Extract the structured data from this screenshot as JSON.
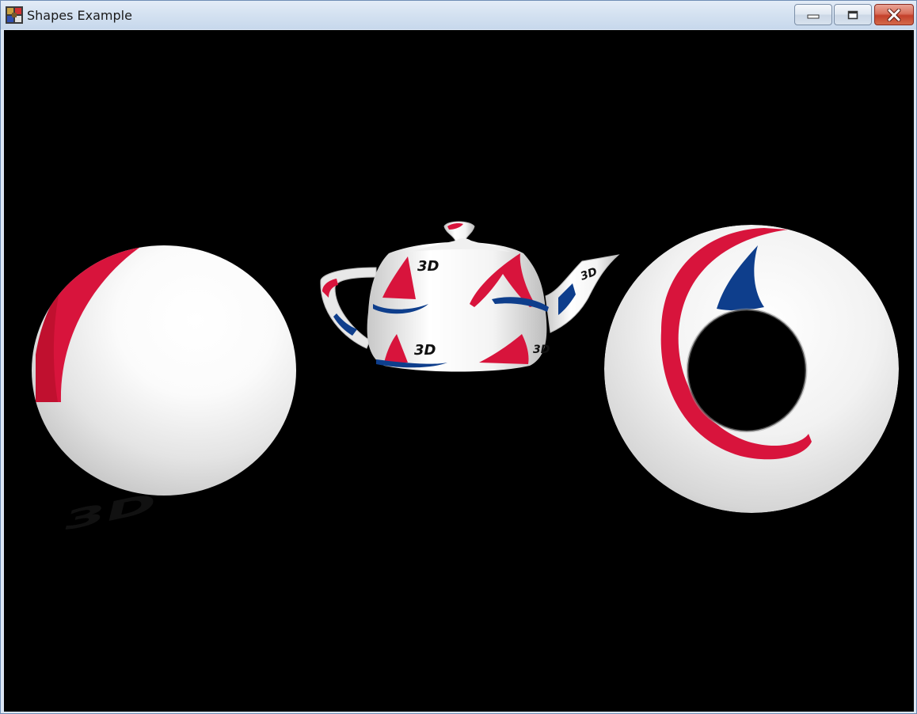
{
  "window": {
    "title": "Shapes Example",
    "icon": "app-icon",
    "controls": {
      "minimize_icon": "minimize-icon",
      "maximize_icon": "maximize-icon",
      "close_icon": "close-icon"
    }
  },
  "scene": {
    "background": "#000000",
    "texture_colors": {
      "red": "#d8143c",
      "blue": "#0e3e8c",
      "base": "#ffffff"
    },
    "objects": [
      {
        "name": "sphere",
        "texture_label": "3D"
      },
      {
        "name": "teapot",
        "texture_label": "3D"
      },
      {
        "name": "torus",
        "texture_label": ""
      }
    ]
  }
}
